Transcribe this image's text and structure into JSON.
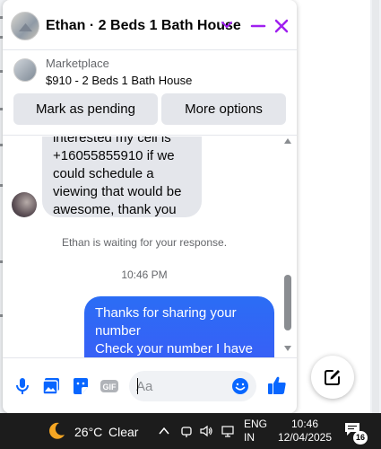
{
  "chat": {
    "title": "Ethan · 2 Beds 1 Bath House",
    "accent_color": "#a020f0"
  },
  "marketplace": {
    "kind": "Marketplace",
    "listing": "$910 - 2 Beds 1 Bath House",
    "mark_pending_label": "Mark as pending",
    "more_options_label": "More options"
  },
  "messages": {
    "incoming_text": "interested my cell is\n+16055855910 if we\ncould schedule a\nviewing that would be\nawesome, thank you",
    "waiting_text": "Ethan is waiting for your response.",
    "timestamp": "10:46 PM",
    "outgoing_text": "Thanks for sharing your\nnumber\nCheck your number I have"
  },
  "composer": {
    "placeholder": "Aa",
    "icons": [
      "microphone-icon",
      "photo-icon",
      "sticker-icon",
      "gif-icon",
      "emoji-icon",
      "like-icon"
    ]
  },
  "taskbar": {
    "temperature": "26°C",
    "condition": "Clear",
    "lang_line1": "ENG",
    "lang_line2": "IN",
    "time": "10:46",
    "date": "12/04/2025",
    "notification_count": "16"
  }
}
